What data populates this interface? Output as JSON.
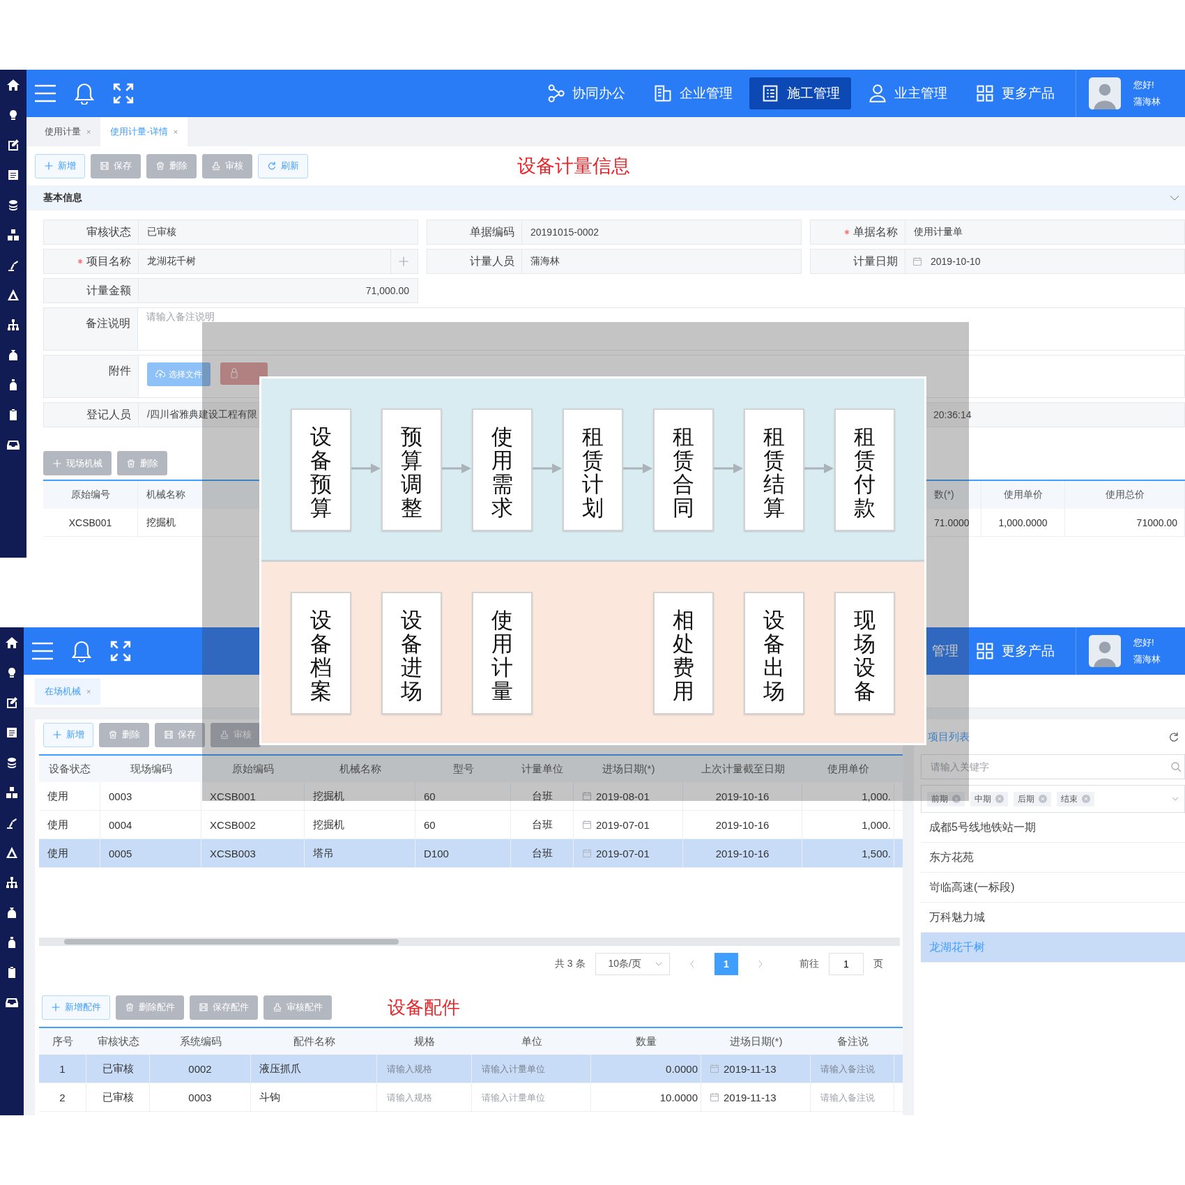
{
  "top_screen": {
    "header": {
      "nav": [
        {
          "label": "协同办公",
          "selected": false
        },
        {
          "label": "企业管理",
          "selected": false
        },
        {
          "label": "施工管理",
          "selected": true
        },
        {
          "label": "业主管理",
          "selected": false
        },
        {
          "label": "更多产品",
          "selected": false
        }
      ],
      "greeting": "您好!",
      "user": "蒲海林"
    },
    "tabs": [
      {
        "label": "使用计量",
        "close": "×",
        "selected": false
      },
      {
        "label": "使用计量-详情",
        "close": "×",
        "selected": true
      }
    ],
    "toolbar": [
      {
        "label": "新增",
        "disabled": false
      },
      {
        "label": "保存",
        "disabled": true
      },
      {
        "label": "删除",
        "disabled": true
      },
      {
        "label": "审核",
        "disabled": true
      },
      {
        "label": "刷新",
        "disabled": false
      }
    ],
    "page_title": "设备计量信息",
    "section_title": "基本信息",
    "fields": [
      {
        "label": "审核状态",
        "kind": "text",
        "required": false,
        "value": "已审核"
      },
      {
        "label": "单据编码",
        "kind": "text",
        "required": false,
        "value": "20191015-0002"
      },
      {
        "label": "单据名称",
        "kind": "text",
        "required": true,
        "value": "使用计量单"
      },
      {
        "label": "项目名称",
        "kind": "lookup",
        "required": true,
        "value": "龙湖花千树"
      },
      {
        "label": "计量人员",
        "kind": "text",
        "required": false,
        "value": "蒲海林"
      },
      {
        "label": "计量日期",
        "kind": "date",
        "required": false,
        "value": "2019-10-10"
      },
      {
        "label": "计量金额",
        "kind": "amount",
        "required": false,
        "value": "71,000.00"
      },
      {
        "label": "备注说明",
        "kind": "textarea",
        "required": false,
        "placeholder": "请输入备注说明"
      },
      {
        "label": "附件",
        "kind": "upload",
        "required": false,
        "button": "选择文件"
      },
      {
        "label": "登记人员",
        "kind": "split",
        "required": false,
        "value": "/四川省雅典建设工程有限",
        "value_2": "20:36:14"
      }
    ],
    "equipment_toolbar": [
      {
        "label": "现场机械",
        "disabled": true
      },
      {
        "label": "删除",
        "disabled": true
      }
    ],
    "equipment_table": {
      "columns": [
        "原始编号",
        "机械名称",
        "数(*)",
        "使用单价",
        "使用总价"
      ],
      "rows": [
        {
          "cells": [
            "XCSB001",
            "挖掘机",
            "71.0000",
            "1,000.0000",
            "71000.00"
          ]
        }
      ]
    }
  },
  "bottom_screen": {
    "header": {
      "nav": [
        {
          "label": "管理",
          "selected": false
        },
        {
          "label": "更多产品",
          "selected": false
        }
      ],
      "greeting": "您好!",
      "user": "蒲海林"
    },
    "tabs": [
      {
        "label": "在场机械",
        "close": "×",
        "selected": true
      }
    ],
    "toolbar": [
      {
        "label": "新增",
        "disabled": false
      },
      {
        "label": "删除",
        "disabled": true
      },
      {
        "label": "保存",
        "disabled": true
      },
      {
        "label": "审核",
        "disabled": true
      }
    ],
    "machine_table": {
      "columns": [
        "设备状态",
        "现场编码",
        "原始编码",
        "机械名称",
        "型号",
        "计量单位",
        "进场日期(*)",
        "上次计量截至日期",
        "使用单价"
      ],
      "rows": [
        {
          "selected": false,
          "cells": [
            "使用",
            "0003",
            "XCSB001",
            "挖掘机",
            "60",
            "台班",
            "2019-08-01",
            "2019-10-16",
            "1,000."
          ]
        },
        {
          "selected": false,
          "cells": [
            "使用",
            "0004",
            "XCSB002",
            "挖掘机",
            "60",
            "台班",
            "2019-07-01",
            "2019-10-16",
            "1,000."
          ]
        },
        {
          "selected": true,
          "cells": [
            "使用",
            "0005",
            "XCSB003",
            "塔吊",
            "D100",
            "台班",
            "2019-07-01",
            "2019-10-16",
            "1,500."
          ]
        }
      ]
    },
    "pagination": {
      "total": "共 3 条",
      "page_size": "10条/页",
      "pages": [
        {
          "label": "1",
          "selected": true
        }
      ],
      "goto_label": "前往",
      "goto_value": "1",
      "goto_suffix": "页"
    },
    "parts_toolbar": [
      {
        "label": "新增配件",
        "disabled": false
      },
      {
        "label": "删除配件",
        "disabled": true
      },
      {
        "label": "保存配件",
        "disabled": true
      },
      {
        "label": "审核配件",
        "disabled": true
      }
    ],
    "parts_title": "设备配件",
    "parts_table": {
      "columns": [
        "序号",
        "审核状态",
        "系统编码",
        "配件名称",
        "规格",
        "单位",
        "数量",
        "进场日期(*)",
        "备注说"
      ],
      "rows": [
        {
          "selected": true,
          "cells": [
            {
              "text": "1"
            },
            {
              "text": "已审核"
            },
            {
              "text": "0002"
            },
            {
              "text": "液压抓爪"
            },
            {
              "placeholder": "请输入规格"
            },
            {
              "placeholder": "请输入计量单位"
            },
            {
              "text": "0.0000"
            },
            {
              "text": "2019-11-13",
              "kind": "date"
            },
            {
              "placeholder": "请输入备注说"
            }
          ]
        },
        {
          "selected": false,
          "cells": [
            {
              "text": "2"
            },
            {
              "text": "已审核"
            },
            {
              "text": "0003"
            },
            {
              "text": "斗钩"
            },
            {
              "placeholder": "请输入规格"
            },
            {
              "placeholder": "请输入计量单位"
            },
            {
              "text": "10.0000"
            },
            {
              "text": "2019-11-13",
              "kind": "date"
            },
            {
              "placeholder": "请输入备注说"
            }
          ]
        }
      ]
    },
    "project_panel": {
      "title": "项目列表",
      "search_placeholder": "请输入关键字",
      "tags": [
        {
          "label": "前期"
        },
        {
          "label": "中期"
        },
        {
          "label": "后期"
        },
        {
          "label": "结束"
        }
      ],
      "projects": [
        {
          "label": "成都5号线地铁站一期",
          "selected": false
        },
        {
          "label": "东方花苑",
          "selected": false
        },
        {
          "label": "岢临高速(一标段)",
          "selected": false
        },
        {
          "label": "万科魅力城",
          "selected": false
        },
        {
          "label": "龙湖花千树",
          "selected": true
        }
      ]
    }
  },
  "flow_diagram": {
    "top_row": [
      {
        "kind": "box",
        "label": "设备预算"
      },
      {
        "kind": "box",
        "label": "预算调整"
      },
      {
        "kind": "box",
        "label": "使用需求"
      },
      {
        "kind": "box",
        "label": "租赁计划"
      },
      {
        "kind": "box",
        "label": "租赁合同"
      },
      {
        "kind": "box",
        "label": "租赁结算"
      },
      {
        "kind": "box",
        "label": "租赁付款"
      }
    ],
    "bottom_row": [
      {
        "kind": "box",
        "label": "设备档案"
      },
      {
        "kind": "box",
        "label": "设备进场"
      },
      {
        "kind": "box",
        "label": "使用计量"
      },
      {
        "kind": "gap"
      },
      {
        "kind": "box",
        "label": "相处费用"
      },
      {
        "kind": "box",
        "label": "设备出场"
      },
      {
        "kind": "box",
        "label": "现场设备"
      }
    ]
  }
}
